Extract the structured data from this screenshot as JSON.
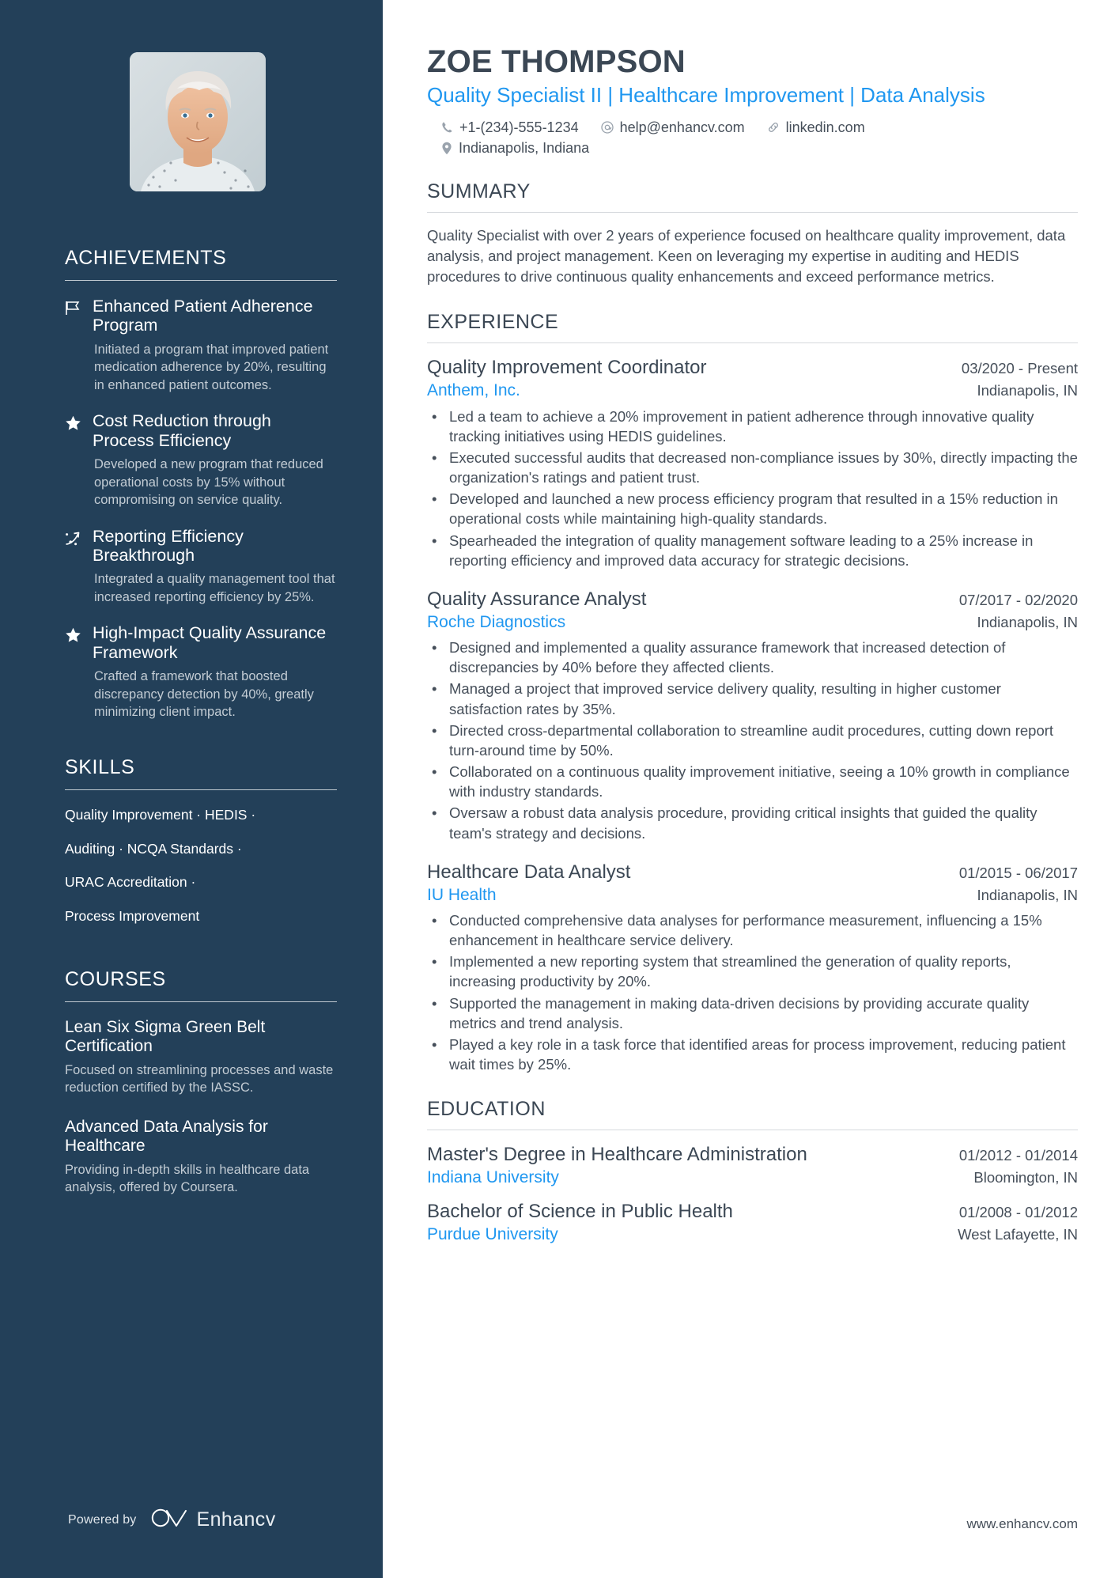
{
  "header": {
    "name": "ZOE THOMPSON",
    "headline": "Quality Specialist II | Healthcare Improvement | Data Analysis",
    "contacts": [
      {
        "icon": "phone-icon",
        "text": "+1-(234)-555-1234"
      },
      {
        "icon": "email-icon",
        "text": "help@enhancv.com"
      },
      {
        "icon": "link-icon",
        "text": "linkedin.com"
      }
    ],
    "location": {
      "icon": "location-pin-icon",
      "text": "Indianapolis, Indiana"
    }
  },
  "sidebar": {
    "achievements": {
      "heading": "ACHIEVEMENTS",
      "items": [
        {
          "icon": "flag-icon",
          "title": "Enhanced Patient Adherence Program",
          "description": "Initiated a program that improved patient medication adherence by 20%, resulting in enhanced patient outcomes."
        },
        {
          "icon": "star-icon",
          "title": "Cost Reduction through Process Efficiency",
          "description": "Developed a new program that reduced operational costs by 15% without compromising on service quality."
        },
        {
          "icon": "trend-arrow-icon",
          "title": "Reporting Efficiency Breakthrough",
          "description": "Integrated a quality management tool that increased reporting efficiency by 25%."
        },
        {
          "icon": "star-icon",
          "title": "High-Impact Quality Assurance Framework",
          "description": "Crafted a framework that boosted discrepancy detection by 40%, greatly minimizing client impact."
        }
      ]
    },
    "skills": {
      "heading": "SKILLS",
      "lines": [
        "Quality Improvement · HEDIS ·",
        "Auditing · NCQA Standards ·",
        "URAC Accreditation ·",
        "Process Improvement"
      ]
    },
    "courses": {
      "heading": "COURSES",
      "items": [
        {
          "title": "Lean Six Sigma Green Belt Certification",
          "description": "Focused on streamlining processes and waste reduction certified by the IASSC."
        },
        {
          "title": "Advanced Data Analysis for Healthcare",
          "description": "Providing in-depth skills in healthcare data analysis, offered by Coursera."
        }
      ]
    },
    "powered_by": {
      "label": "Powered by",
      "brand": "Enhancv"
    }
  },
  "main": {
    "summary": {
      "heading": "SUMMARY",
      "text": "Quality Specialist with over 2 years of experience focused on healthcare quality improvement, data analysis, and project management. Keen on leveraging my expertise in auditing and HEDIS procedures to drive continuous quality enhancements and exceed performance metrics."
    },
    "experience": {
      "heading": "EXPERIENCE",
      "entries": [
        {
          "title": "Quality Improvement Coordinator",
          "date": "03/2020 - Present",
          "org": "Anthem, Inc.",
          "location": "Indianapolis, IN",
          "bullets": [
            "Led a team to achieve a 20% improvement in patient adherence through innovative quality tracking initiatives using HEDIS guidelines.",
            "Executed successful audits that decreased non-compliance issues by 30%, directly impacting the organization's ratings and patient trust.",
            "Developed and launched a new process efficiency program that resulted in a 15% reduction in operational costs while maintaining high-quality standards.",
            "Spearheaded the integration of quality management software leading to a 25% increase in reporting efficiency and improved data accuracy for strategic decisions."
          ]
        },
        {
          "title": "Quality Assurance Analyst",
          "date": "07/2017 - 02/2020",
          "org": "Roche Diagnostics",
          "location": "Indianapolis, IN",
          "bullets": [
            "Designed and implemented a quality assurance framework that increased detection of discrepancies by 40% before they affected clients.",
            "Managed a project that improved service delivery quality, resulting in higher customer satisfaction rates by 35%.",
            "Directed cross-departmental collaboration to streamline audit procedures, cutting down report turn-around time by 50%.",
            "Collaborated on a continuous quality improvement initiative, seeing a 10% growth in compliance with industry standards.",
            "Oversaw a robust data analysis procedure, providing critical insights that guided the quality team's strategy and decisions."
          ]
        },
        {
          "title": "Healthcare Data Analyst",
          "date": "01/2015 - 06/2017",
          "org": "IU Health",
          "location": "Indianapolis, IN",
          "bullets": [
            "Conducted comprehensive data analyses for performance measurement, influencing a 15% enhancement in healthcare service delivery.",
            "Implemented a new reporting system that streamlined the generation of quality reports, increasing productivity by 20%.",
            "Supported the management in making data-driven decisions by providing accurate quality metrics and trend analysis.",
            "Played a key role in a task force that identified areas for process improvement, reducing patient wait times by 25%."
          ]
        }
      ]
    },
    "education": {
      "heading": "EDUCATION",
      "entries": [
        {
          "title": "Master's Degree in Healthcare Administration",
          "date": "01/2012 - 01/2014",
          "org": "Indiana University",
          "location": "Bloomington, IN"
        },
        {
          "title": "Bachelor of Science in Public Health",
          "date": "01/2008 - 01/2012",
          "org": "Purdue University",
          "location": "West Lafayette, IN"
        }
      ]
    },
    "footer_url": "www.enhancv.com"
  },
  "colors": {
    "sidebar_bg": "#234059",
    "accent_blue": "#1f97f0",
    "heading_dark": "#3b4754",
    "body_text": "#464f5a",
    "sidebar_muted": "#c3ccd4"
  }
}
